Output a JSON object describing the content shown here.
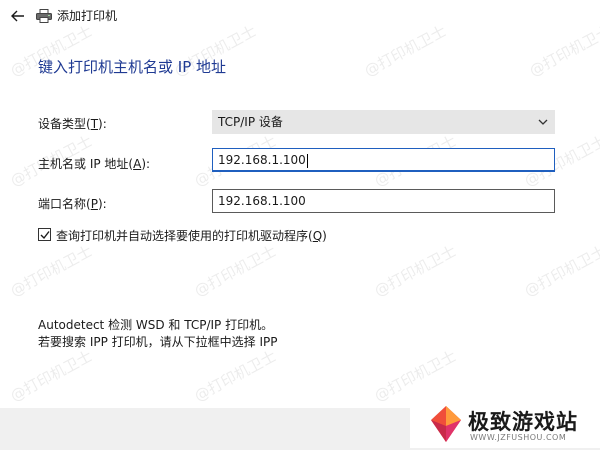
{
  "window": {
    "title": "添加打印机"
  },
  "heading": "键入打印机主机名或 IP 地址",
  "device_type": {
    "label_prefix": "设备类型(",
    "label_key": "T",
    "label_suffix": "):",
    "selected": "TCP/IP 设备"
  },
  "hostname": {
    "label_prefix": "主机名或 IP 地址(",
    "label_key": "A",
    "label_suffix": "):",
    "value": "192.168.1.100"
  },
  "port": {
    "label_prefix": "端口名称(",
    "label_key": "P",
    "label_suffix": "):",
    "value": "192.168.1.100"
  },
  "query_driver": {
    "checked": true,
    "label_prefix": "查询打印机并自动选择要使用的打印机驱动程序(",
    "label_key": "Q",
    "label_suffix": ")"
  },
  "info": {
    "line1": "Autodetect 检测 WSD 和 TCP/IP 打印机。",
    "line2": "若要搜索 IPP 打印机，请从下拉框中选择 IPP"
  },
  "watermark": "@打印机卫士",
  "brand": {
    "name": "极致游戏站",
    "url": "WWW.JZFUSHOU.COM"
  }
}
